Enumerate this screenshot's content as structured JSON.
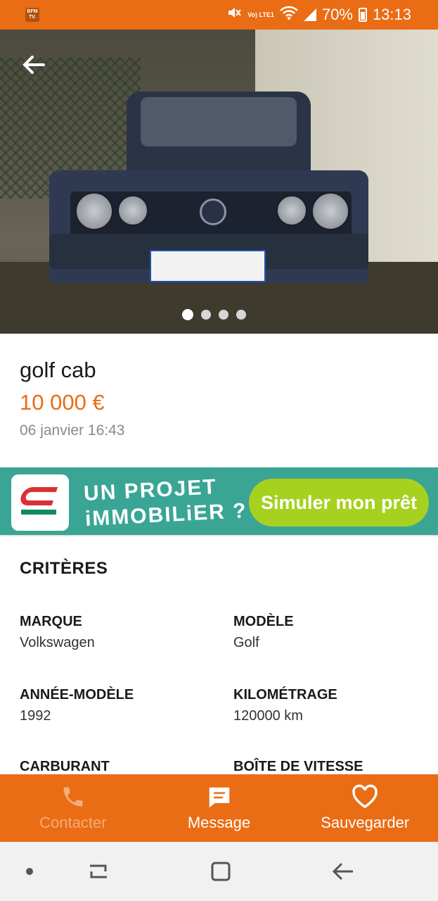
{
  "status_bar": {
    "left_icon_text": "BFM TV.",
    "lte_label": "Vo) LTE1",
    "battery_percent": "70%",
    "time": "13:13"
  },
  "photo": {
    "slide_count": 4,
    "active_slide": 1
  },
  "ad": {
    "title": "golf cab",
    "price": "10 000 €",
    "date": "06 janvier 16:43"
  },
  "banner": {
    "text_line1": "UN PROJET",
    "text_line2": "iMMOBILiER ?",
    "cta": "Simuler mon prêt"
  },
  "criteria": {
    "title": "CRITÈRES",
    "items": [
      {
        "label": "MARQUE",
        "value": "Volkswagen"
      },
      {
        "label": "MODÈLE",
        "value": "Golf"
      },
      {
        "label": "ANNÉE-MODÈLE",
        "value": "1992"
      },
      {
        "label": "KILOMÉTRAGE",
        "value": "120000 km"
      },
      {
        "label": "CARBURANT",
        "value": ""
      },
      {
        "label": "BOÎTE DE VITESSE",
        "value": ""
      }
    ]
  },
  "actions": {
    "contact": "Contacter",
    "message": "Message",
    "save": "Sauvegarder"
  },
  "colors": {
    "brand_orange": "#ea6c14",
    "banner_teal": "#3aa595",
    "banner_cta_green": "#a6d11f"
  }
}
